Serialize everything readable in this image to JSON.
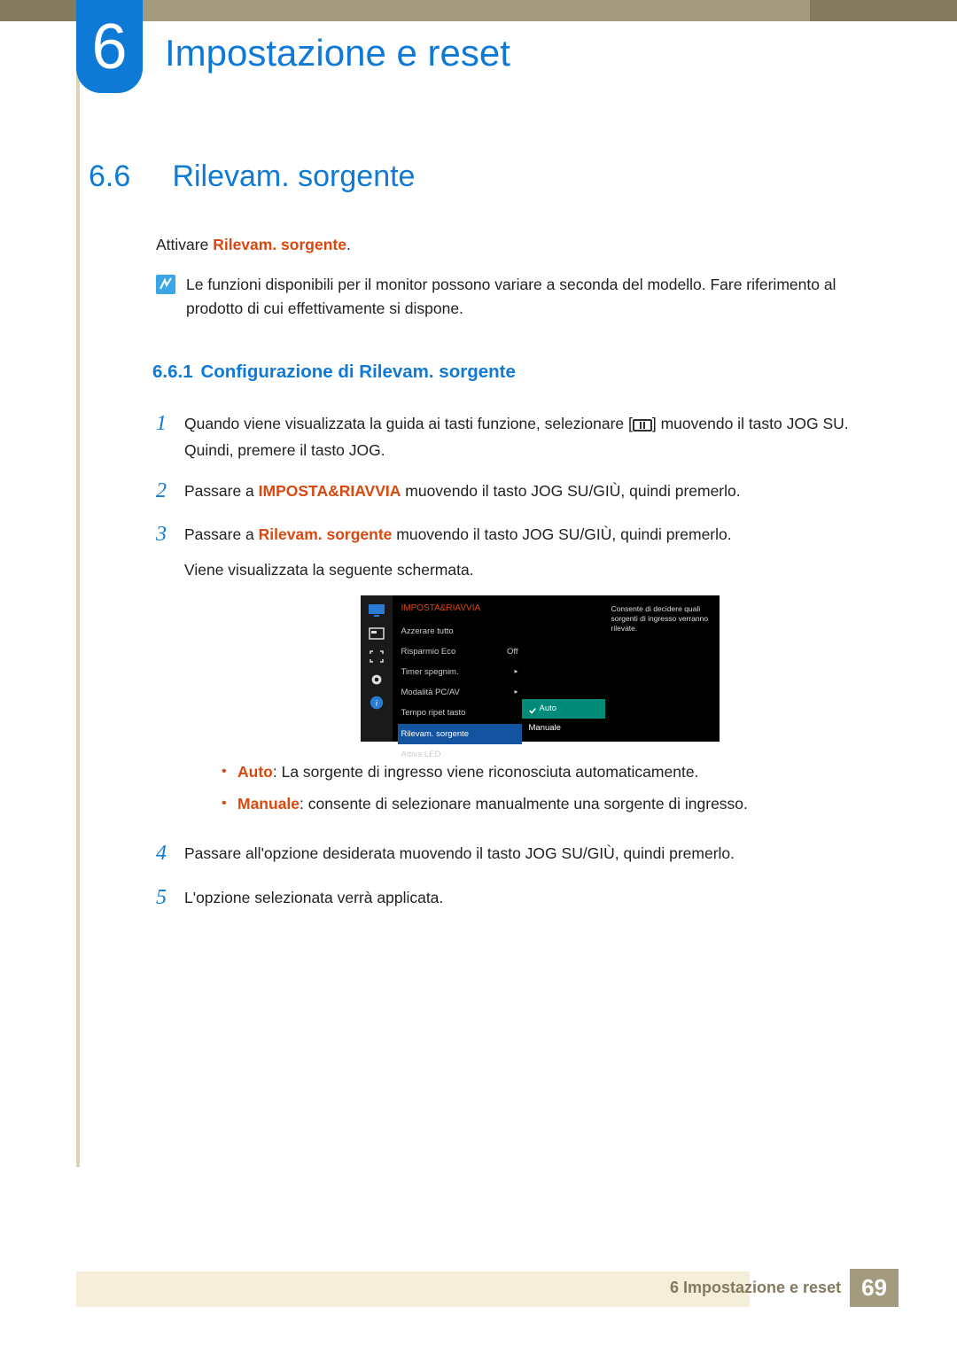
{
  "chapter": {
    "number": "6",
    "title": "Impostazione e reset"
  },
  "section": {
    "number": "6.6",
    "title": "Rilevam. sorgente"
  },
  "intro": {
    "prefix": "Attivare ",
    "highlight": "Rilevam. sorgente",
    "suffix": "."
  },
  "note": "Le funzioni disponibili per il monitor possono variare a seconda del modello. Fare riferimento al prodotto di cui effettivamente si dispone.",
  "subsection": {
    "number": "6.6.1",
    "title": "Configurazione di Rilevam. sorgente"
  },
  "steps": {
    "s1a": "Quando viene visualizzata la guida ai tasti funzione, selezionare [",
    "s1b": "] muovendo il tasto JOG SU. Quindi, premere il tasto JOG.",
    "s2a": "Passare a ",
    "s2hl": "IMPOSTA&RIAVVIA",
    "s2b": " muovendo il tasto JOG SU/GIÙ, quindi premerlo.",
    "s3a": "Passare a ",
    "s3hl": "Rilevam. sorgente",
    "s3b": " muovendo il tasto JOG SU/GIÙ, quindi premerlo.",
    "s3c": "Viene visualizzata la seguente schermata.",
    "s4": "Passare all'opzione desiderata muovendo il tasto JOG SU/GIÙ, quindi premerlo.",
    "s5": "L'opzione selezionata verrà applicata."
  },
  "step_numbers": {
    "n1": "1",
    "n2": "2",
    "n3": "3",
    "n4": "4",
    "n5": "5"
  },
  "osd": {
    "title": "IMPOSTA&RIAVVIA",
    "items": {
      "reset": {
        "label": "Azzerare tutto",
        "value": ""
      },
      "eco": {
        "label": "Risparmio Eco",
        "value": "Off"
      },
      "timer": {
        "label": "Timer spegnim.",
        "value": "▸"
      },
      "pcav": {
        "label": "Modalità PC/AV",
        "value": "▸"
      },
      "repeat": {
        "label": "Tempo ripet tasto",
        "value": ""
      },
      "src": {
        "label": "Rilevam. sorgente",
        "value": ""
      },
      "led": {
        "label": "Attiva LED",
        "value": ""
      }
    },
    "submenu": {
      "auto": "Auto",
      "manual": "Manuale"
    },
    "desc": "Consente di decidere quali sorgenti di ingresso verranno rilevate."
  },
  "bullets": {
    "auto_hl": "Auto",
    "auto_txt": ": La sorgente di ingresso viene riconosciuta automaticamente.",
    "manual_hl": "Manuale",
    "manual_txt": ": consente di selezionare manualmente una sorgente di ingresso."
  },
  "footer": {
    "text": "6 Impostazione e reset",
    "page": "69"
  }
}
